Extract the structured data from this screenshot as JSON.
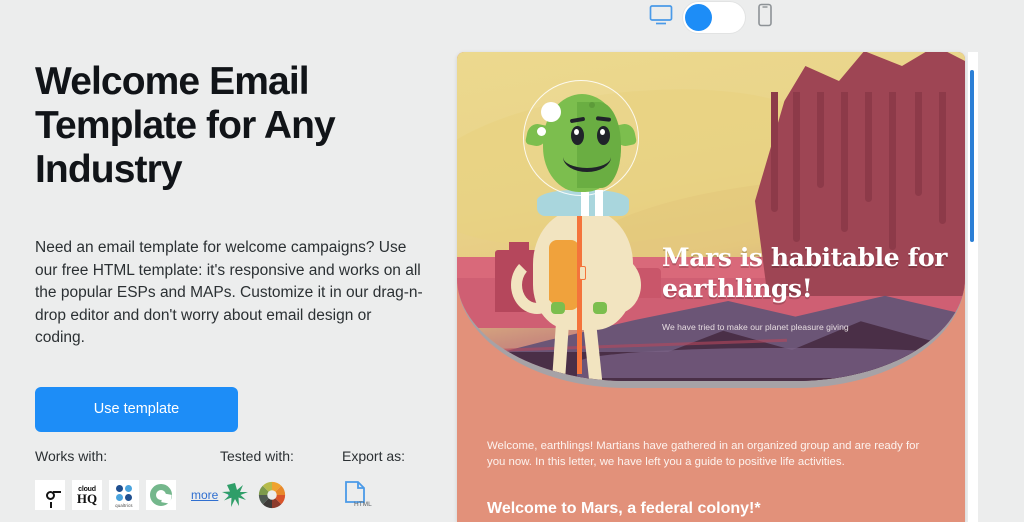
{
  "page": {
    "title": "Welcome Email Template for Any Industry",
    "description": "Need an email template for welcome campaigns? Use our free HTML template: it's responsive and works on all the popular ESPs and MAPs. Customize it in our drag-n-drop editor and don't worry about email design or coding.",
    "cta_label": "Use template",
    "accent_color": "#1d8df7",
    "background_color": "#eceded"
  },
  "device_toggle": {
    "desktop_icon": "monitor-icon",
    "mobile_icon": "smartphone-icon",
    "state": "desktop",
    "knob_color": "#1d8df7"
  },
  "badges": {
    "works_with": {
      "label": "Works with:",
      "logos": [
        {
          "name": "keyhole-logo",
          "alt": "esp-logo"
        },
        {
          "name": "cloudhq-logo",
          "line1": "cloud",
          "line2": "HQ"
        },
        {
          "name": "qualtrics-logo",
          "wordmark": "qualtrics"
        },
        {
          "name": "green-ring-logo",
          "alt": "esp-logo"
        }
      ],
      "more_label": "more",
      "more_plus": "+"
    },
    "tested_with": {
      "label": "Tested with:",
      "logos": [
        {
          "name": "litmus-splat-logo",
          "color": "#2f9e68"
        },
        {
          "name": "email-on-acid-wheel-logo"
        }
      ]
    },
    "export_as": {
      "label": "Export as:",
      "logos": [
        {
          "name": "html-file-icon",
          "caption": "HTML",
          "color": "#4a9ae8"
        }
      ]
    }
  },
  "preview": {
    "hero": {
      "headline": "Mars is habitable for earthlings!",
      "subtitle": "We have tried to make our planet pleasure giving",
      "illustration": "alien-on-mars-illustration"
    },
    "body": {
      "paragraph": "Welcome, earthlings! Martians have gathered in an organized group and are ready for you now. In this letter, we have left you a guide to positive life activities.",
      "heading": "Welcome to Mars, a federal colony!*"
    },
    "background_color": "#e2917a",
    "scrollbar_color": "#2b7fd6"
  }
}
